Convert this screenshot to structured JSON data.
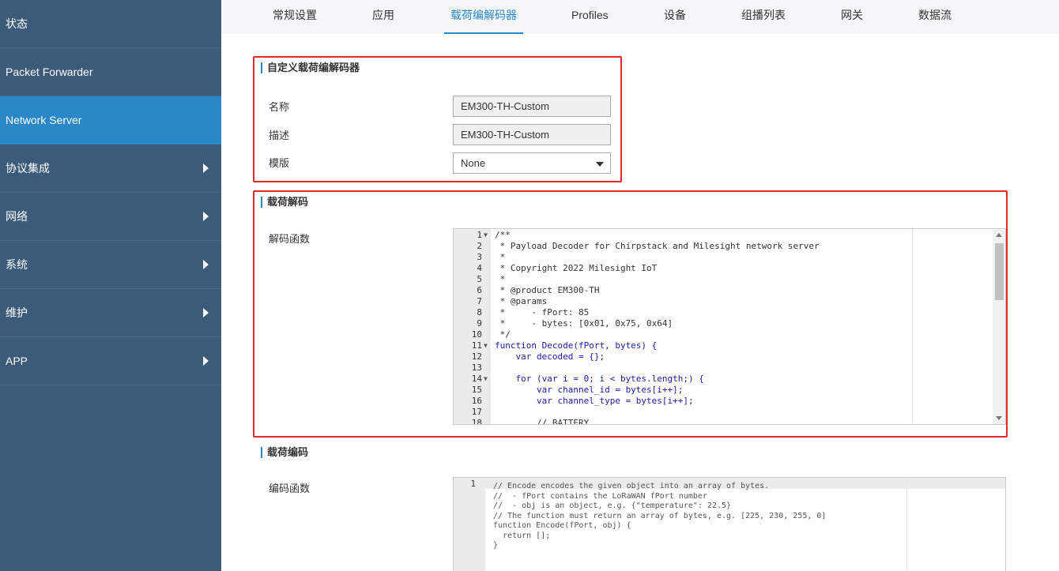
{
  "sidebar": {
    "items": [
      {
        "label": "状态",
        "active": false,
        "has_arrow": false
      },
      {
        "label": "Packet Forwarder",
        "active": false,
        "has_arrow": false
      },
      {
        "label": "Network Server",
        "active": true,
        "has_arrow": false
      },
      {
        "label": "协议集成",
        "active": false,
        "has_arrow": true
      },
      {
        "label": "网络",
        "active": false,
        "has_arrow": true
      },
      {
        "label": "系统",
        "active": false,
        "has_arrow": true
      },
      {
        "label": "维护",
        "active": false,
        "has_arrow": true
      },
      {
        "label": "APP",
        "active": false,
        "has_arrow": true
      }
    ]
  },
  "tabs": [
    {
      "label": "常规设置",
      "active": false
    },
    {
      "label": "应用",
      "active": false
    },
    {
      "label": "载荷编解码器",
      "active": true
    },
    {
      "label": "Profiles",
      "active": false
    },
    {
      "label": "设备",
      "active": false
    },
    {
      "label": "组播列表",
      "active": false
    },
    {
      "label": "网关",
      "active": false
    },
    {
      "label": "数据流",
      "active": false
    }
  ],
  "custom_codec": {
    "title": "自定义载荷编解码器",
    "name_label": "名称",
    "name_value": "EM300-TH-Custom",
    "desc_label": "描述",
    "desc_value": "EM300-TH-Custom",
    "template_label": "模版",
    "template_value": "None"
  },
  "decoder": {
    "title": "载荷解码",
    "func_label": "解码函数",
    "lines": [
      {
        "n": "1",
        "fold": true,
        "text": "/**"
      },
      {
        "n": "2",
        "fold": false,
        "text": " * Payload Decoder for Chirpstack and Milesight network server"
      },
      {
        "n": "3",
        "fold": false,
        "text": " *"
      },
      {
        "n": "4",
        "fold": false,
        "text": " * Copyright 2022 Milesight IoT"
      },
      {
        "n": "5",
        "fold": false,
        "text": " *"
      },
      {
        "n": "6",
        "fold": false,
        "text": " * @product EM300-TH"
      },
      {
        "n": "7",
        "fold": false,
        "text": " * @params"
      },
      {
        "n": "8",
        "fold": false,
        "text": " *     - fPort: 85"
      },
      {
        "n": "9",
        "fold": false,
        "text": " *     - bytes: [0x01, 0x75, 0x64]"
      },
      {
        "n": "10",
        "fold": false,
        "text": " */"
      },
      {
        "n": "11",
        "fold": true,
        "text": "function Decode(fPort, bytes) {"
      },
      {
        "n": "12",
        "fold": false,
        "text": "    var decoded = {};"
      },
      {
        "n": "13",
        "fold": false,
        "text": ""
      },
      {
        "n": "14",
        "fold": true,
        "text": "    for (var i = 0; i < bytes.length;) {"
      },
      {
        "n": "15",
        "fold": false,
        "text": "        var channel_id = bytes[i++];"
      },
      {
        "n": "16",
        "fold": false,
        "text": "        var channel_type = bytes[i++];"
      },
      {
        "n": "17",
        "fold": false,
        "text": ""
      },
      {
        "n": "18",
        "fold": false,
        "text": "        // BATTERY"
      }
    ]
  },
  "encoder": {
    "title": "载荷编码",
    "func_label": "编码函数",
    "line_number": "1",
    "lines": [
      "// Encode encodes the given object into an array of bytes.",
      "//  - fPort contains the LoRaWAN fPort number",
      "//  - obj is an object, e.g. {\"temperature\": 22.5}",
      "// The function must return an array of bytes, e.g. [225, 230, 255, 0]",
      "function Encode(fPort, obj) {",
      "  return [];",
      "}"
    ]
  },
  "colors": {
    "sidebar_bg": "#3c5a7a",
    "active_bg": "#2a87c8",
    "highlight_border": "#e32b2b"
  }
}
